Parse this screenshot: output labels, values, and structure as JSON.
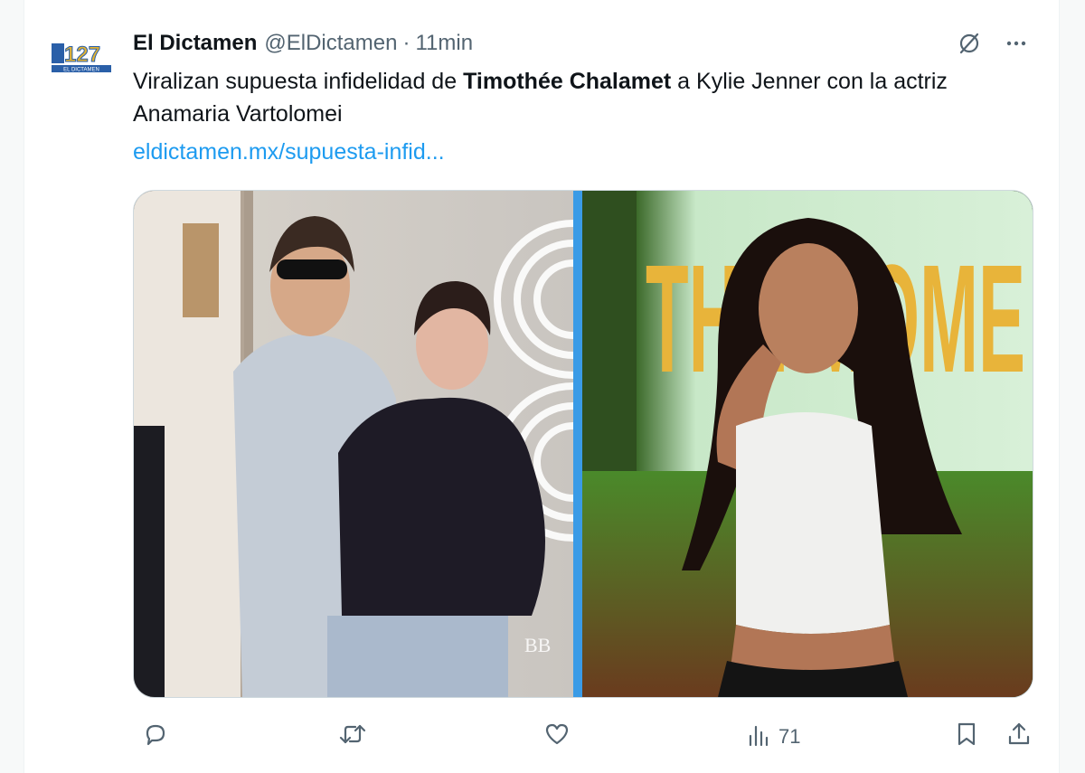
{
  "author": {
    "name": "El Dictamen",
    "handle": "@ElDictamen",
    "separator": "·",
    "time": "11min",
    "avatar_text": "127",
    "avatar_subtext": "EL DICTAMEN"
  },
  "tweet": {
    "text_before": "Viralizan supuesta infidelidad de ",
    "text_bold": "Timothée Chalamet",
    "text_after": " a Kylie Jenner con la actriz Anamaria Vartolomei",
    "link": "eldictamen.mx/supuesta-infid..."
  },
  "media": {
    "left_overlay": "BB",
    "right_sign": "THE MOME"
  },
  "actions": {
    "reply_icon": "reply-icon",
    "retweet_icon": "retweet-icon",
    "like_icon": "like-icon",
    "views_icon": "views-icon",
    "views_count": "71",
    "bookmark_icon": "bookmark-icon",
    "share_icon": "share-icon"
  },
  "top_icons": {
    "grok_icon": "slashed-circle-icon",
    "more_icon": "more-icon",
    "more_label": "···"
  },
  "colors": {
    "link": "#1d9bf0",
    "secondary_text": "#536471",
    "divider": "#3a9be6"
  }
}
